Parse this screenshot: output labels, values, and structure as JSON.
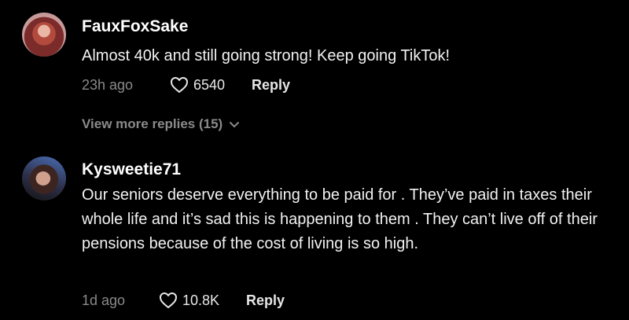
{
  "comments": [
    {
      "username": "FauxFoxSake",
      "text": "Almost 40k and still going strong! Keep going TikTok!",
      "time": "23h ago",
      "likes": "6540",
      "reply_label": "Reply",
      "view_more": "View more replies (15)"
    },
    {
      "username": "Kysweetie71",
      "text": "Our seniors deserve everything to be paid for . They’ve paid in taxes their whole life and it’s sad this is happening to them . They can’t live off of their pensions because of the cost of living is so high.",
      "time": "1d ago",
      "likes": "10.8K",
      "reply_label": "Reply"
    }
  ],
  "icons": {
    "like": "heart-icon",
    "expand": "chevron-down-icon"
  },
  "colors": {
    "background": "#000000",
    "text": "#ffffff",
    "muted": "#8a8a8a"
  }
}
